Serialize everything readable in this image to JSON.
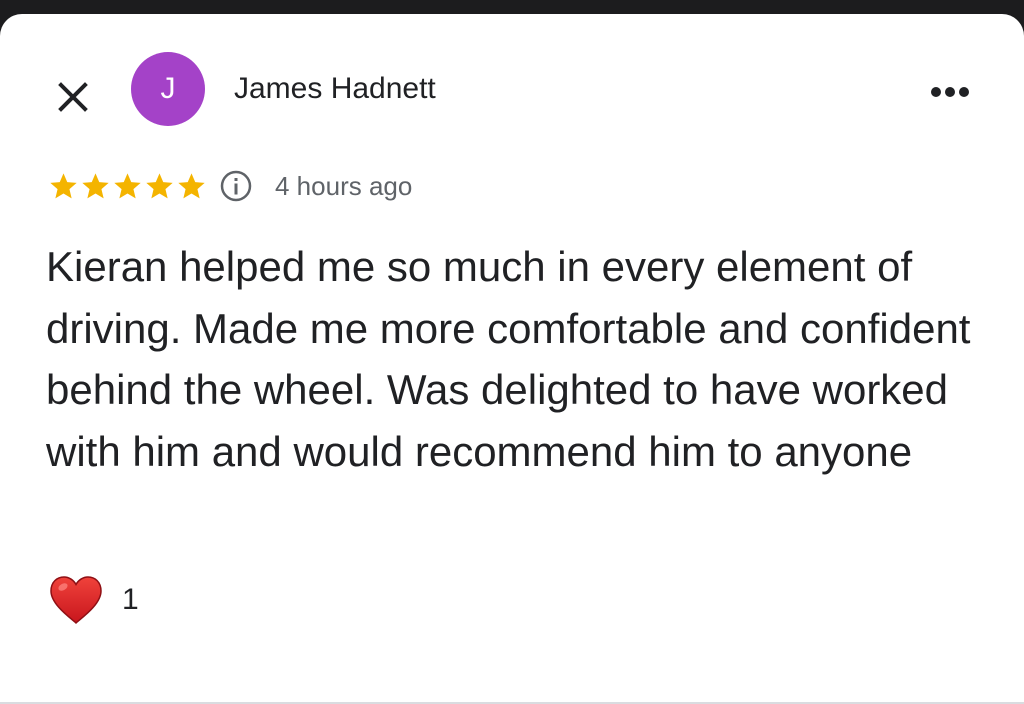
{
  "review": {
    "author": {
      "name": "James Hadnett",
      "initial": "J",
      "avatar_color": "#a442c8"
    },
    "rating": 5,
    "rating_max": 5,
    "star_color": "#f4b400",
    "time_ago": "4 hours ago",
    "text": "Kieran helped me so much in every element of driving. Made me more comfortable and confident behind the wheel. Was delighted to have worked with him and would recommend him to anyone",
    "reactions": {
      "icon": "heart-icon",
      "count": "1"
    }
  },
  "icons": {
    "close": "close-icon",
    "more": "more-options-icon",
    "info": "info-icon",
    "star": "star-icon"
  }
}
